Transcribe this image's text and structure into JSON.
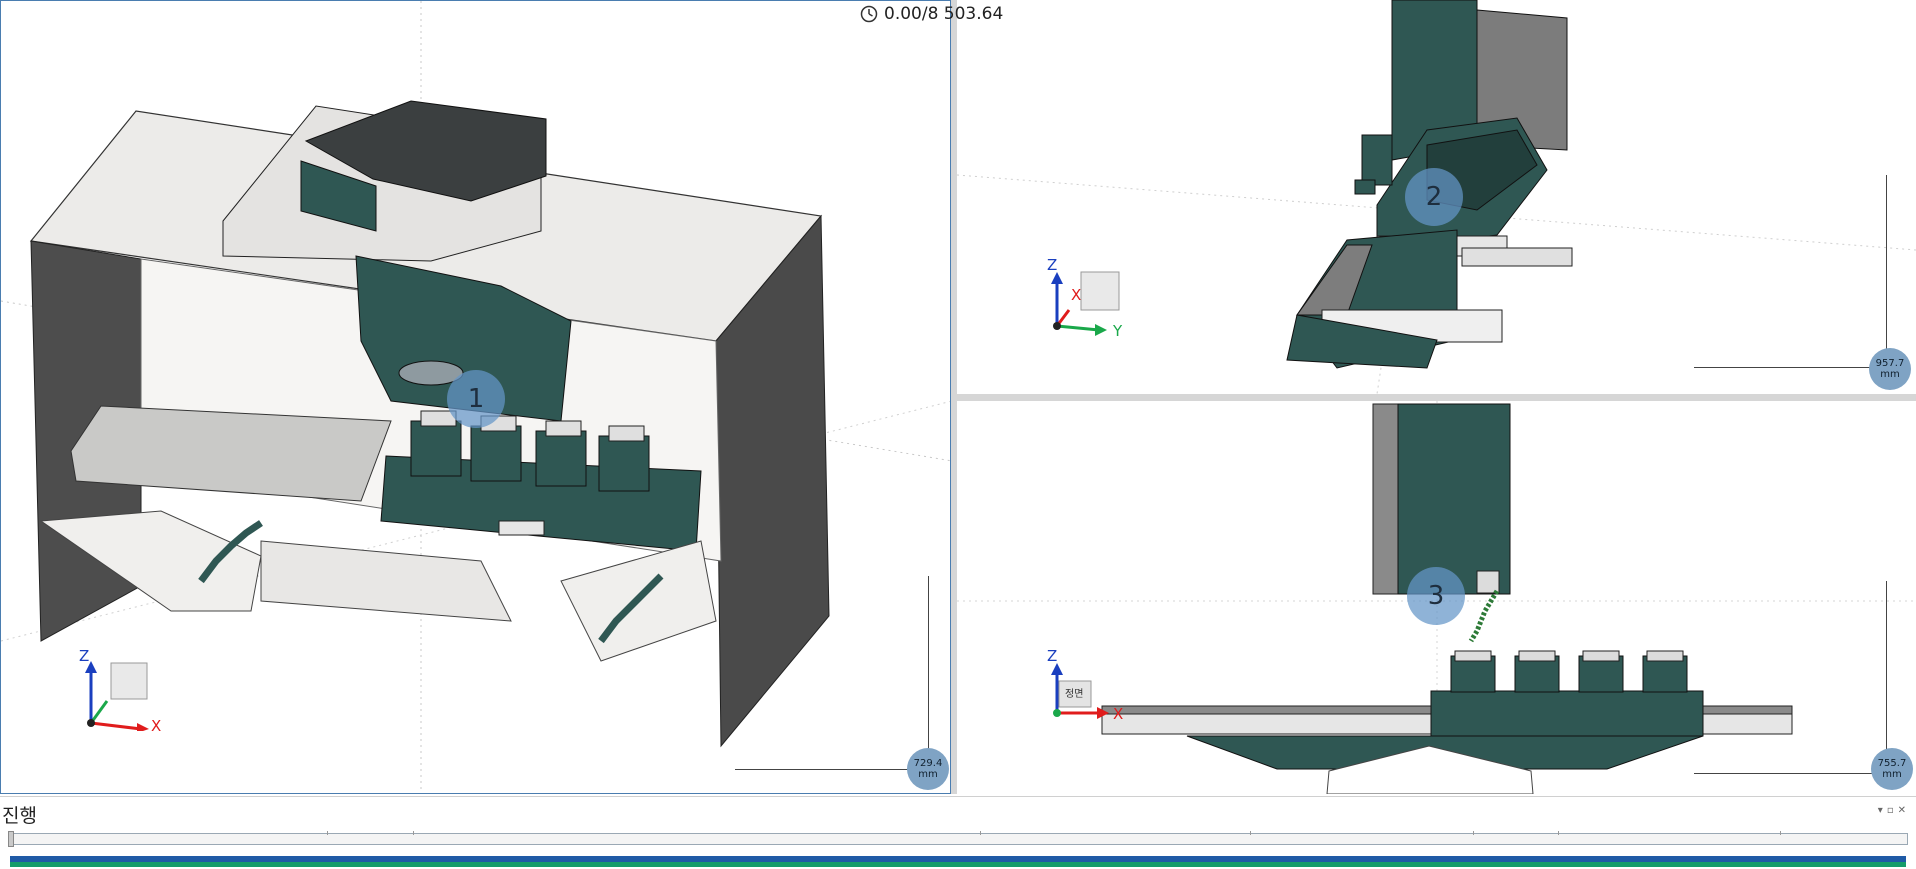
{
  "header": {
    "time_readout": "0.00/8 503.64"
  },
  "viewports": [
    {
      "badge": "1",
      "scale_value": "729.4",
      "scale_unit": "mm",
      "axes": [
        "Z",
        "X",
        "Y"
      ]
    },
    {
      "badge": "2",
      "scale_value": "957.7",
      "scale_unit": "mm",
      "axes": [
        "Z",
        "X",
        "Y"
      ]
    },
    {
      "badge": "3",
      "scale_value": "755.7",
      "scale_unit": "mm",
      "axes": [
        "Z",
        "X"
      ]
    }
  ],
  "view_cube": {
    "front_label": "정면"
  },
  "panel": {
    "title": "진행"
  },
  "colors": {
    "machine": "#2f5753",
    "guard": "#e8e6e4",
    "accent": "#4a7db0"
  }
}
